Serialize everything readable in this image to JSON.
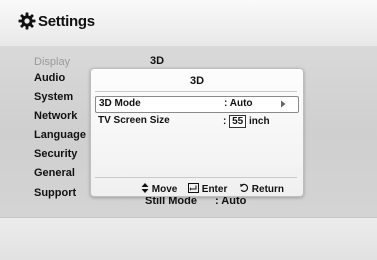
{
  "header": {
    "title": "Settings",
    "icon": "gear-icon"
  },
  "sidebar": {
    "items": [
      {
        "label": "Display",
        "active": true
      },
      {
        "label": "Audio"
      },
      {
        "label": "System"
      },
      {
        "label": "Network"
      },
      {
        "label": "Language"
      },
      {
        "label": "Security"
      },
      {
        "label": "General"
      },
      {
        "label": "Support"
      }
    ]
  },
  "main": {
    "section_title": "3D",
    "bottom_row": {
      "label": "Still Mode",
      "value": ": Auto"
    }
  },
  "dialog": {
    "title": "3D",
    "rows": [
      {
        "label": "3D Mode",
        "value": ": Auto",
        "selected": true
      },
      {
        "label": "TV Screen Size",
        "colon": ":",
        "size_value": "55",
        "unit": "inch"
      }
    ],
    "nav": {
      "move": "Move",
      "enter": "Enter",
      "return": "Return"
    }
  }
}
